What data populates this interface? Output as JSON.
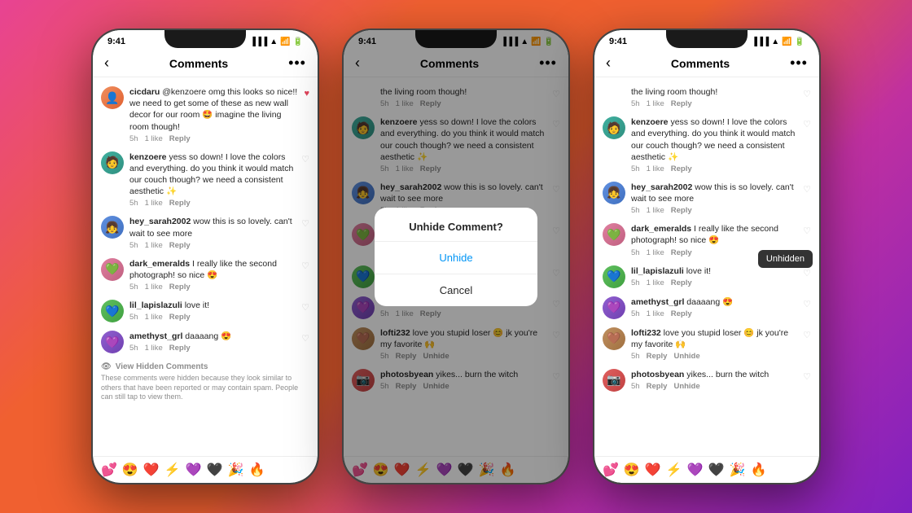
{
  "phones": [
    {
      "id": "phone1",
      "time": "9:41",
      "title": "Comments",
      "comments": [
        {
          "username": "cicdaru",
          "text": "@kenzoere omg this looks so nice!! we need to get some of these as new wall decor for our room 🤩 imagine the living room though!",
          "time": "5h",
          "likes": "1 like",
          "heart": "red"
        },
        {
          "username": "kenzoere",
          "text": "yess so down! I love the colors and everything. do you think it would match our couch though? we need a consistent aesthetic ✨",
          "time": "5h",
          "likes": "1 like",
          "heart": ""
        },
        {
          "username": "hey_sarah2002",
          "text": "wow this is so lovely. can't wait to see more",
          "time": "5h",
          "likes": "1 like",
          "heart": ""
        },
        {
          "username": "dark_emeralds",
          "text": "I really like the second photograph! so nice 😍",
          "time": "5h",
          "likes": "1 like",
          "heart": ""
        },
        {
          "username": "lil_lapislazuli",
          "text": "love it!",
          "time": "5h",
          "likes": "1 like",
          "heart": ""
        },
        {
          "username": "amethyst_grl",
          "text": "daaaang 😍",
          "time": "5h",
          "likes": "1 like",
          "heart": ""
        }
      ],
      "hidden": {
        "show": true,
        "label": "View Hidden Comments",
        "desc": "These comments were hidden because they look similar to others that have been reported or may contain spam. People can still tap to view them."
      },
      "emojis": [
        "💕",
        "😍",
        "❤️",
        "⚡",
        "💜",
        "🖤",
        "🎉",
        "🔥"
      ]
    },
    {
      "id": "phone2",
      "time": "9:41",
      "title": "Comments",
      "hasDialog": true,
      "dialogTitle": "Unhide Comment?",
      "dialogUnhide": "Unhide",
      "dialogCancel": "Cancel",
      "comments": [
        {
          "username": "",
          "text": "the living room though!",
          "time": "5h",
          "likes": "1 like",
          "noAvatar": true,
          "heart": ""
        },
        {
          "username": "kenzoere",
          "text": "yess so down! I love the colors and everything. do you think it would match our couch though? we need a consistent aesthetic ✨",
          "time": "5h",
          "likes": "1 like",
          "heart": ""
        },
        {
          "username": "hey_sarah2002",
          "text": "wow this is so lovely. can't wait to see more",
          "time": "5h",
          "likes": "1 like",
          "heart": ""
        },
        {
          "username": "dark_emeralds",
          "text": "I really like the second photograph! so nice 😍",
          "time": "5h",
          "likes": "1 like",
          "heart": ""
        },
        {
          "username": "lil_lapislazuli",
          "text": "love it!",
          "time": "5h",
          "likes": "1 like",
          "heart": ""
        },
        {
          "username": "amethyst_grl",
          "text": "daaaang 😍",
          "time": "5h",
          "likes": "1 like",
          "heart": ""
        },
        {
          "username": "lofti232",
          "text": "love you stupid loser 😊 jk you're my favorite 🙌",
          "time": "5h",
          "likes": "",
          "heart": "",
          "hasUnhide": true
        },
        {
          "username": "photosbyean",
          "text": "yikes... burn the witch",
          "time": "5h",
          "likes": "",
          "heart": "",
          "hasUnhide": true
        }
      ],
      "emojis": [
        "💕",
        "😍",
        "❤️",
        "⚡",
        "💜",
        "🖤",
        "🎉",
        "🔥"
      ]
    },
    {
      "id": "phone3",
      "time": "9:41",
      "title": "Comments",
      "hasTooltip": true,
      "tooltipText": "Unhidden",
      "comments": [
        {
          "username": "",
          "text": "the living room though!",
          "time": "5h",
          "likes": "1 like",
          "noAvatar": true,
          "heart": ""
        },
        {
          "username": "kenzoere",
          "text": "yess so down! I love the colors and everything. do you think it would match our couch though? we need a consistent aesthetic ✨",
          "time": "5h",
          "likes": "1 like",
          "heart": ""
        },
        {
          "username": "hey_sarah2002",
          "text": "wow this is so lovely. can't wait to see more",
          "time": "5h",
          "likes": "1 like",
          "heart": ""
        },
        {
          "username": "dark_emeralds",
          "text": "I really like the second photograph! so nice 😍",
          "time": "5h",
          "likes": "1 like",
          "heart": ""
        },
        {
          "username": "lil_lapislazuli",
          "text": "love it!",
          "time": "5h",
          "likes": "1 like",
          "heart": "",
          "hasTooltip": true
        },
        {
          "username": "amethyst_grl",
          "text": "daaaang 😍",
          "time": "5h",
          "likes": "1 like",
          "heart": ""
        },
        {
          "username": "lofti232",
          "text": "love you stupid loser 😊 jk you're my favorite 🙌",
          "time": "5h",
          "likes": "",
          "heart": "",
          "hasUnhide": true
        },
        {
          "username": "photosbyean",
          "text": "yikes... burn the witch",
          "time": "5h",
          "likes": "",
          "heart": "",
          "hasUnhide": true
        }
      ],
      "emojis": [
        "💕",
        "😍",
        "❤️",
        "⚡",
        "💜",
        "🖤",
        "🎉",
        "🔥"
      ]
    }
  ],
  "avatarColors": {
    "cicdaru": "av-orange",
    "kenzoere": "av-teal",
    "hey_sarah2002": "av-blue",
    "dark_emeralds": "av-pink",
    "lil_lapislazuli": "av-green",
    "amethyst_grl": "av-purple",
    "lofti232": "av-brown",
    "photosbyean": "av-red"
  }
}
